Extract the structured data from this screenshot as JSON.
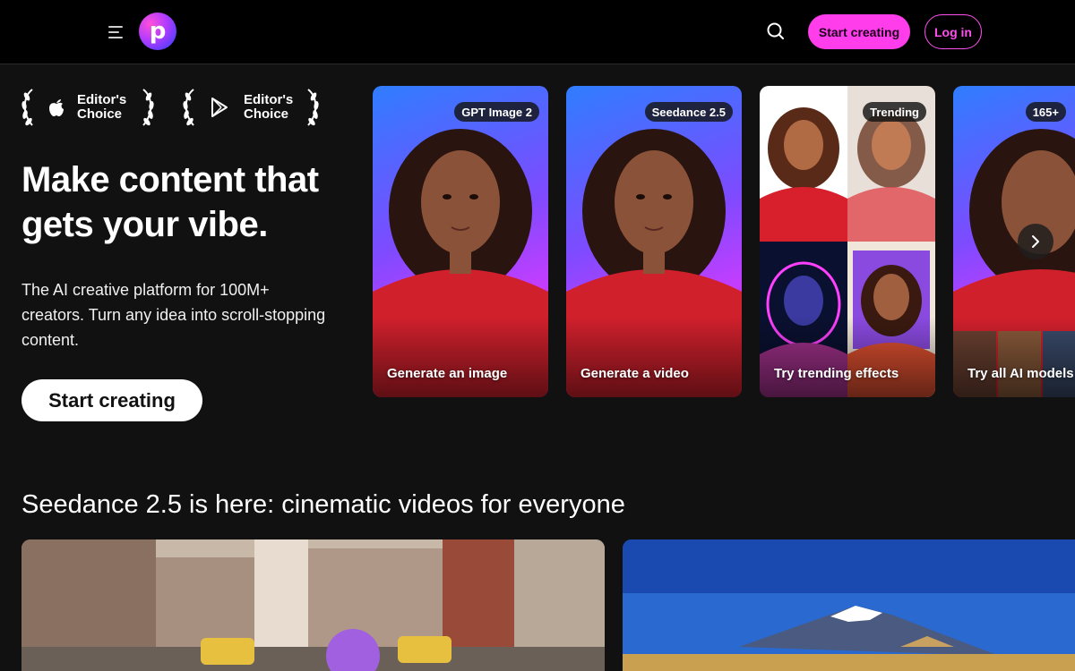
{
  "header": {
    "menu_icon": "hamburger-menu-icon",
    "logo_letter": "p",
    "search_icon": "search-icon",
    "start_label": "Start creating",
    "login_label": "Log in",
    "colors": {
      "accent": "#ff3dea",
      "background": "#000000"
    }
  },
  "awards": [
    {
      "icon": "apple-icon",
      "line1": "Editor's",
      "line2": "Choice"
    },
    {
      "icon": "google-play-icon",
      "line1": "Editor's",
      "line2": "Choice"
    }
  ],
  "hero": {
    "title": "Make content that gets your vibe.",
    "subtitle": "The AI creative platform for 100M+ creators. Turn any idea into scroll-stopping content.",
    "cta_label": "Start creating"
  },
  "cards": [
    {
      "badge": "GPT Image 2",
      "label": "Generate an image"
    },
    {
      "badge": "Seedance 2.5",
      "label": "Generate a video"
    },
    {
      "badge": "Trending",
      "label": "Try trending effects"
    },
    {
      "badge": "165+",
      "label": "Try all AI models"
    }
  ],
  "carousel": {
    "next_icon": "chevron-right-icon"
  },
  "section": {
    "title": "Seedance 2.5 is here: cinematic videos for everyone"
  }
}
